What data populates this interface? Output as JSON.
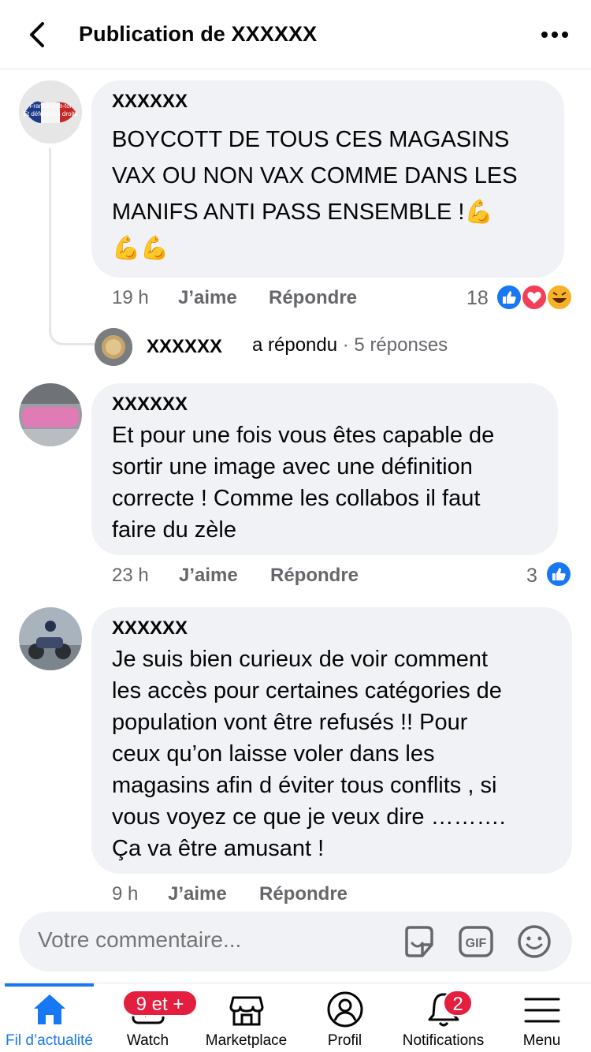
{
  "header": {
    "title": "Publication de XXXXXX"
  },
  "comments": [
    {
      "author": "XXXXXX",
      "text_lines": [
        "BOYCOTT DE TOUS CES MAGASINS",
        "VAX OU NON VAX COMME DANS LES",
        "MANIFS ANTI PASS ENSEMBLE  !💪",
        "💪💪"
      ],
      "time": "19 h",
      "like_label": "J’aime",
      "reply_label": "Répondre",
      "reaction_count": "18",
      "avatar_text_1": "France lève-toi",
      "avatar_text_2": "Et défend tes droits"
    },
    {
      "author": "XXXXXX",
      "text_lines": [
        "Et pour une fois vous êtes capable de",
        "sortir une image avec une définition",
        "correcte ! Comme les collabos il faut",
        "faire du zèle"
      ],
      "time": "23 h",
      "like_label": "J’aime",
      "reply_label": "Répondre",
      "reaction_count": "3"
    },
    {
      "author": "XXXXXX",
      "text_lines": [
        "Je suis bien curieux de voir comment",
        "les accès pour certaines catégories de",
        "population vont être refusés  !! Pour",
        "ceux qu’on laisse voler dans les",
        "magasins afin d éviter tous conflits  , si",
        "vous voyez ce que je veux dire ……….",
        "Ça va être amusant !"
      ],
      "time": "9 h",
      "like_label": "J’aime",
      "reply_label": "Répondre"
    }
  ],
  "reply_summary": {
    "name": "XXXXXX",
    "action": "a répondu",
    "separator": " · ",
    "count": "5 réponses"
  },
  "composer": {
    "placeholder": "Votre commentaire..."
  },
  "tabs": [
    {
      "label": "Fil d’actualité",
      "icon": "home-icon",
      "active": true
    },
    {
      "label": "Watch",
      "icon": "watch-icon",
      "badge": "9 et +"
    },
    {
      "label": "Marketplace",
      "icon": "marketplace-icon"
    },
    {
      "label": "Profil",
      "icon": "profile-icon"
    },
    {
      "label": "Notifications",
      "icon": "bell-icon",
      "badge": "2"
    },
    {
      "label": "Menu",
      "icon": "menu-icon"
    }
  ],
  "colors": {
    "accent": "#1877f2",
    "bubble": "#f0f2f5",
    "muted": "#65676b",
    "badge": "#e41e3f"
  }
}
